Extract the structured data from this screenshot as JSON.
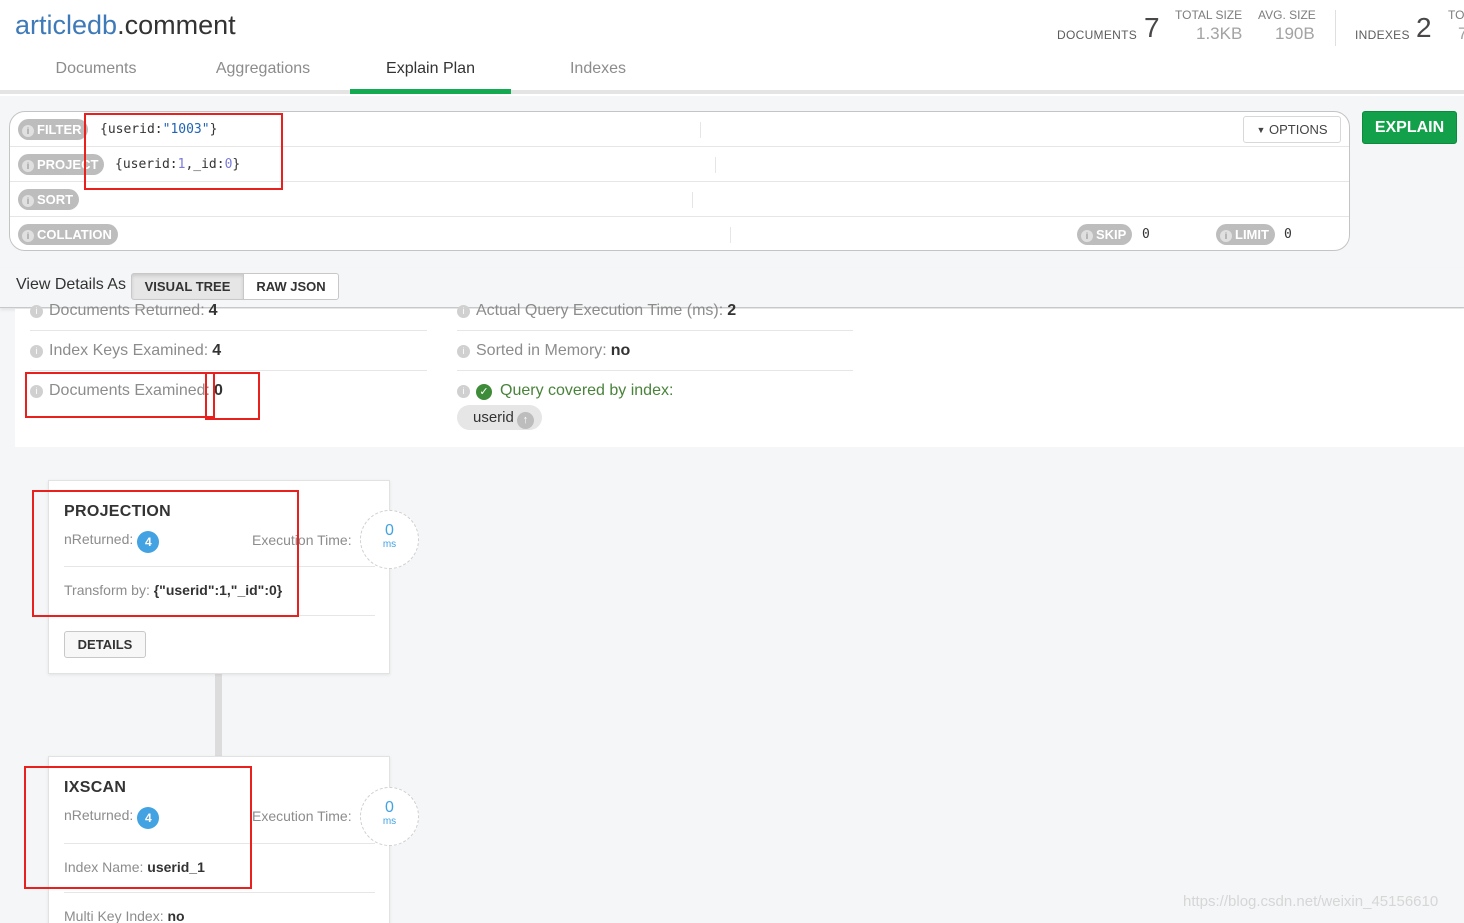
{
  "header": {
    "db_name": "articledb",
    "collection_name": ".comment",
    "documents_label": "DOCUMENTS",
    "documents_count": "7",
    "total_size_label": "TOTAL SIZE",
    "total_size_value": "1.3KB",
    "avg_size_label": "AVG. SIZE",
    "avg_size_value": "190B",
    "indexes_label": "INDEXES",
    "indexes_count": "2",
    "truncated_label": "TO",
    "truncated_value": "7"
  },
  "tabs": [
    {
      "label": "Documents",
      "active": false
    },
    {
      "label": "Aggregations",
      "active": false
    },
    {
      "label": "Explain Plan",
      "active": true
    },
    {
      "label": "Indexes",
      "active": false
    }
  ],
  "query_bar": {
    "filter_label": "FILTER",
    "filter_value_prefix": "{userid:",
    "filter_value_string": "\"1003\"",
    "filter_value_suffix": "}",
    "project_label": "PROJECT",
    "project_value_a": "{userid:",
    "project_value_b": "1",
    "project_value_c": ",_id:",
    "project_value_d": "0",
    "project_value_e": "}",
    "sort_label": "SORT",
    "collation_label": "COLLATION",
    "skip_label": "SKIP",
    "skip_value": "0",
    "limit_label": "LIMIT",
    "limit_value": "0",
    "options_label": "OPTIONS",
    "explain_label": "EXPLAIN"
  },
  "view_details": {
    "label": "View Details As",
    "visual_tree": "VISUAL TREE",
    "raw_json": "RAW JSON"
  },
  "summary": {
    "docs_returned_label": "Documents Returned:",
    "docs_returned_value": "4",
    "index_keys_label": "Index Keys Examined:",
    "index_keys_value": "4",
    "docs_examined_label": "Documents Examined:",
    "docs_examined_value": "0",
    "exec_time_label": "Actual Query Execution Time (ms):",
    "exec_time_value": "2",
    "sorted_label": "Sorted in Memory:",
    "sorted_value": "no",
    "covered_label": "Query covered by index:",
    "index_chip": "userid"
  },
  "stages": [
    {
      "name": "PROJECTION",
      "nreturned_label": "nReturned:",
      "nreturned": "4",
      "exec_label": "Execution Time:",
      "exec_value": "0",
      "exec_unit": "ms",
      "detail_label": "Transform by:",
      "detail_value": "{\"userid\":1,\"_id\":0}",
      "details_button": "DETAILS"
    },
    {
      "name": "IXSCAN",
      "nreturned_label": "nReturned:",
      "nreturned": "4",
      "exec_label": "Execution Time:",
      "exec_value": "0",
      "exec_unit": "ms",
      "detail_label": "Index Name:",
      "detail_value": "userid_1",
      "detail2_label": "Multi Key Index:",
      "detail2_value": "no"
    }
  ],
  "watermark": "https://blog.csdn.net/weixin_45156610",
  "colors": {
    "accent_green": "#13aa52",
    "explain_green": "#13a04a",
    "badge_blue": "#43a2e1",
    "annotation_red": "#e8211f",
    "db_blue": "#3e7ab8"
  }
}
